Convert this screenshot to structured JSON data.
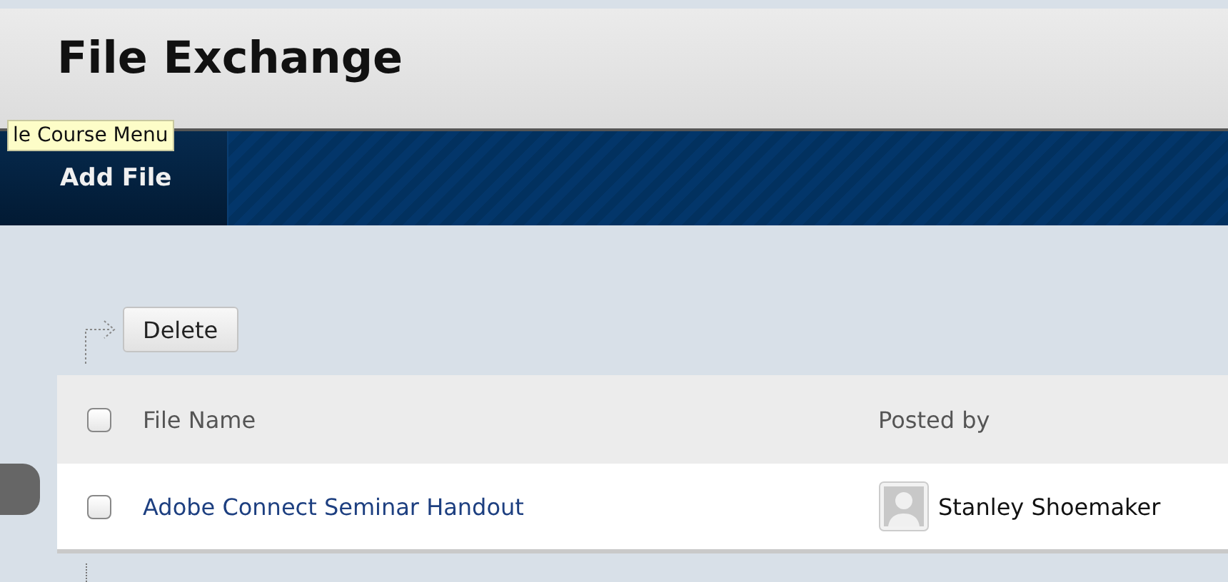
{
  "page_title": "File Exchange",
  "tooltip": "le Course Menu",
  "action_bar": {
    "tabs": [
      {
        "label": "Add File",
        "selected": true
      }
    ]
  },
  "toolbar": {
    "buttons": [
      "Delete"
    ]
  },
  "table": {
    "columns": [
      {
        "label": "File Name",
        "select_all": false
      },
      {
        "label": "Posted by"
      }
    ],
    "rows": [
      {
        "checked": false,
        "file_name": "Adobe Connect Seminar Handout",
        "posted_by": "Stanley Shoemaker"
      }
    ]
  }
}
